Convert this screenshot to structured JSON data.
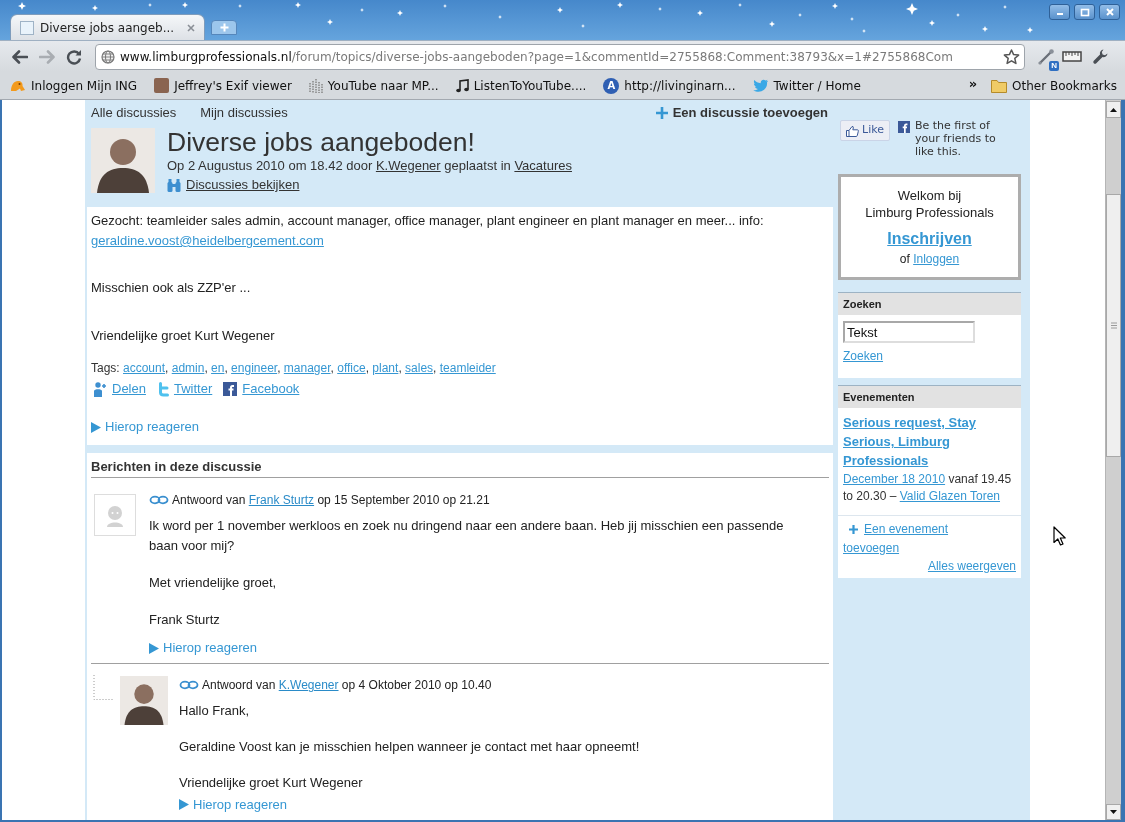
{
  "browser": {
    "tabs": [
      {
        "title": "Diverse jobs aangeb...",
        "selected": true
      }
    ],
    "back": {
      "disabled": false
    },
    "forward": {
      "disabled": true
    },
    "url": {
      "host": "www.limburgprofessionals.nl",
      "path": "/forum/topics/diverse-jobs-aangeboden?page=1&commentId=2755868:Comment:38793&x=1#2755868Com"
    },
    "extension_badge": "N",
    "bookmarks": [
      {
        "label": "Inloggen Mijn ING"
      },
      {
        "label": "Jeffrey's Exif viewer"
      },
      {
        "label": "YouTube naar MP..."
      },
      {
        "label": "ListenToYouTube...."
      },
      {
        "label": "http://livinginarn...",
        "icon_text": "A"
      },
      {
        "label": "Twitter / Home"
      }
    ],
    "bookmarks_overflow": "»",
    "other_bookmarks": "Other Bookmarks"
  },
  "nav": {
    "links": [
      "Alle discussies",
      "Mijn discussies"
    ],
    "add": "Een discussie toevoegen"
  },
  "discussion": {
    "title": "Diverse jobs aangeboden!",
    "meta": {
      "date": "Op 2 Augustus 2010 om 18.42 door",
      "author": "K.Wegener",
      "posted_in": "geplaatst in",
      "category": "Vacatures"
    },
    "view_all": "Discussies bekijken",
    "paragraphs": [
      {
        "text": "Gezocht: teamleider sales admin, account manager, office manager, plant engineer en plant manager en meer... info:",
        "link": "geraldine.voost@heidelbergcement.com"
      },
      {
        "text": "Misschien ook als ZZP'er ..."
      },
      {
        "text": "Vriendelijke groet Kurt Wegener"
      }
    ],
    "tags": {
      "label": "Tags:",
      "separator": ",",
      "items": [
        "account",
        "admin",
        "en",
        "engineer",
        "manager",
        "office",
        "plant",
        "sales",
        "teamleider"
      ]
    },
    "share": [
      "Delen",
      "Twitter",
      "Facebook"
    ],
    "reply": "Hierop reageren"
  },
  "comments": {
    "title": "Berichten in deze discussie",
    "items": [
      {
        "kind": "guest",
        "prefix": "Antwoord van",
        "author": "Frank Sturtz",
        "date": "op 15 September 2010 op 21.21",
        "paragraphs": [
          "Ik word per 1 november werkloos en zoek nu dringend naar een andere baan. Heb jij misschien een passende baan voor mij?",
          "Met vriendelijke groet,",
          "Frank Sturtz"
        ],
        "reply": "Hierop reageren",
        "children": [
          {
            "kind": "member",
            "prefix": "Antwoord van",
            "author": "K.Wegener",
            "date": "op 4 Oktober 2010 op 10.40",
            "paragraphs": [
              "Hallo Frank,",
              "Geraldine Voost kan je misschien helpen wanneer je contact met haar opneemt!",
              "Vriendelijke groet Kurt Wegener"
            ],
            "reply": "Hierop reageren"
          }
        ]
      }
    ]
  },
  "sidebar": {
    "like": {
      "button": "Like",
      "text": "Be the first of your friends to like this."
    },
    "welcome": {
      "lines": [
        "Welkom bij",
        "Limburg Professionals"
      ],
      "signup": "Inschrijven",
      "or": "of",
      "login": "Inloggen"
    },
    "search": {
      "title": "Zoeken",
      "value": "Tekst",
      "submit": "Zoeken"
    },
    "events": {
      "title": "Evenementen",
      "items": [
        {
          "title": "Serious request, Stay Serious, Limburg Professionals",
          "date": "December 18 2010",
          "time": "vanaf 19.45 to 20.30 –",
          "venue": "Valid Glazen Toren"
        }
      ],
      "add": "Een evenement toevoegen",
      "all": "Alles weergeven"
    }
  }
}
